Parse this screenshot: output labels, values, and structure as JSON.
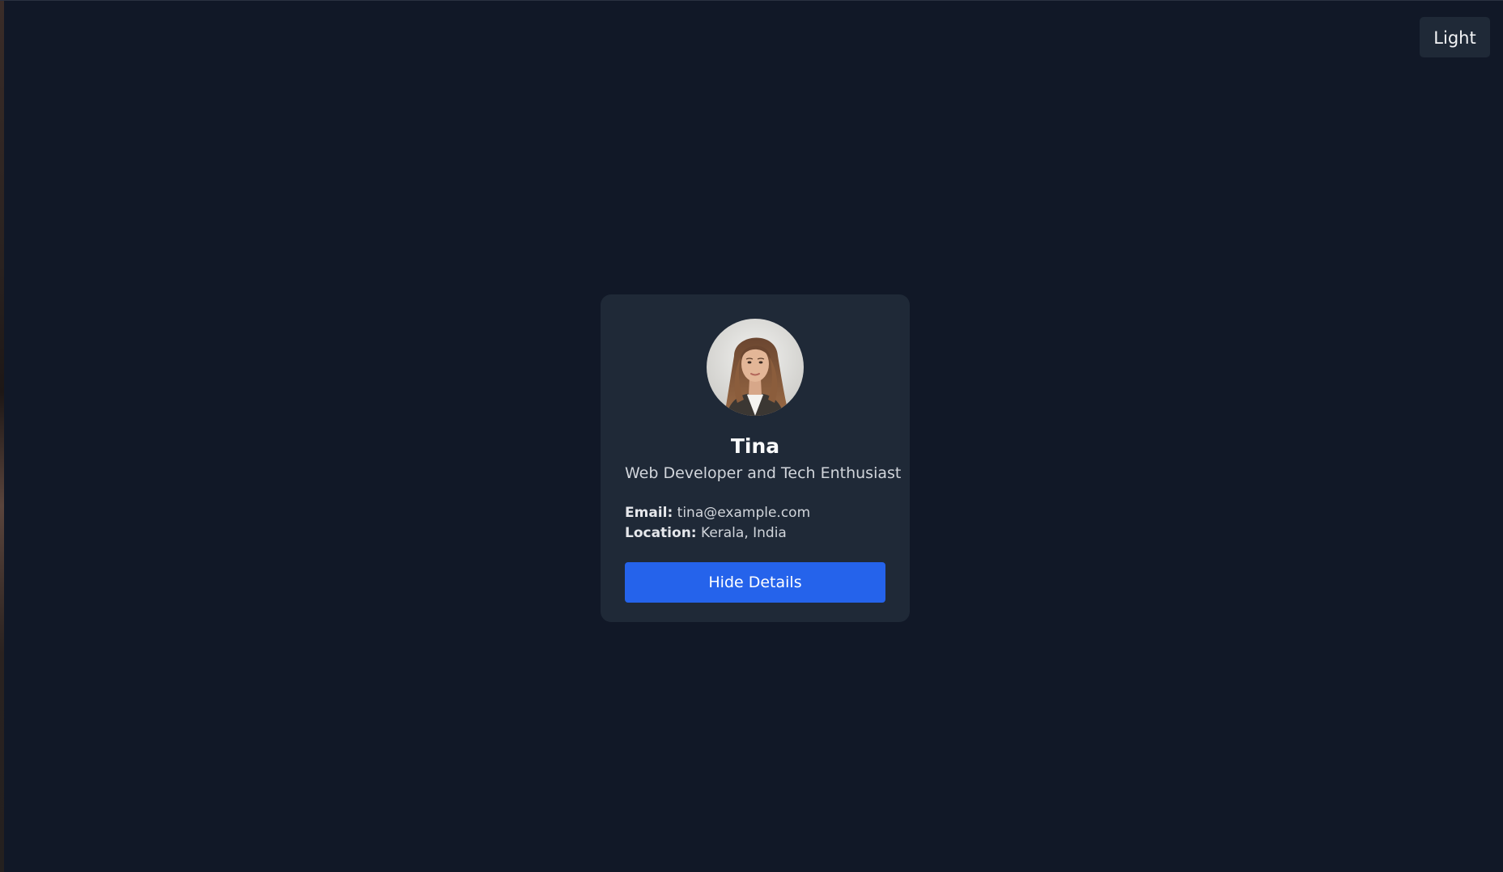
{
  "theme_toggle": {
    "label": "Light"
  },
  "profile": {
    "name": "Tina",
    "role": "Web Developer and Tech Enthusiast",
    "email_label": "Email:",
    "email": "tina@example.com",
    "location_label": "Location:",
    "location": "Kerala, India",
    "toggle_button_label": "Hide Details"
  },
  "colors": {
    "background": "#111827",
    "card": "#1f2937",
    "accent": "#2563eb"
  }
}
